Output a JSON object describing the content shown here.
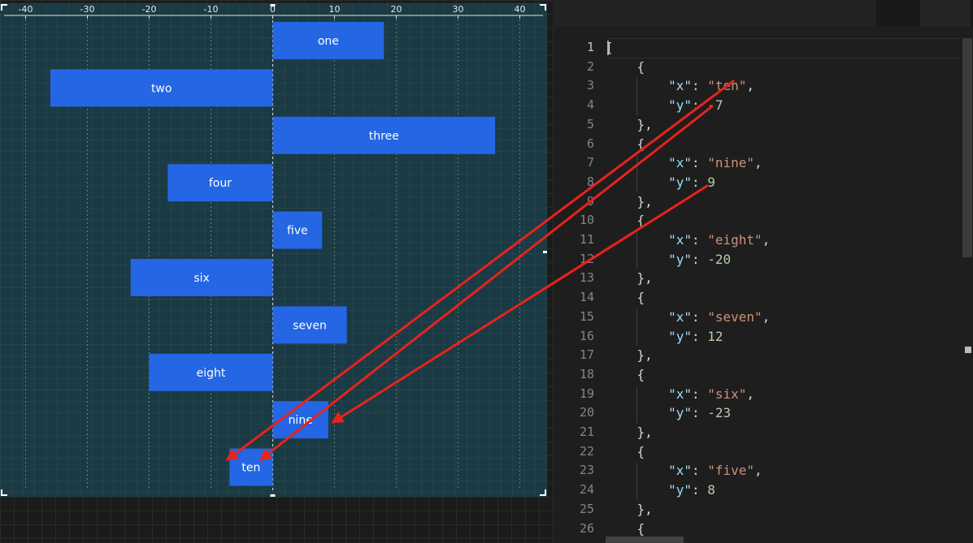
{
  "chart_data": {
    "type": "bar",
    "orientation": "horizontal",
    "categories": [
      "one",
      "two",
      "three",
      "four",
      "five",
      "six",
      "seven",
      "eight",
      "nine",
      "ten"
    ],
    "values": [
      18,
      -36,
      36,
      -17,
      8,
      -23,
      12,
      -20,
      9,
      -7
    ],
    "xlim": [
      -42,
      44
    ],
    "ticks": [
      -40,
      -30,
      -20,
      -10,
      0,
      10,
      20,
      30,
      40
    ],
    "tick_labels": [
      "-40",
      "-30",
      "-20",
      "-10",
      "0",
      "10",
      "20",
      "30",
      "40"
    ],
    "grid": true,
    "bar_color": "#2466e3"
  },
  "editor": {
    "line_numbers": [
      "1",
      "2",
      "3",
      "4",
      "5",
      "6",
      "7",
      "8",
      "9",
      "10",
      "11",
      "12",
      "13",
      "14",
      "15",
      "16",
      "17",
      "18",
      "19",
      "20",
      "21",
      "22",
      "23",
      "24",
      "25",
      "26"
    ],
    "active_line": 1,
    "lines": [
      [
        {
          "t": "p",
          "v": "["
        }
      ],
      [
        {
          "t": "p",
          "v": "    {"
        }
      ],
      [
        {
          "t": "p",
          "v": "        "
        },
        {
          "t": "k",
          "v": "\"x\""
        },
        {
          "t": "p",
          "v": ": "
        },
        {
          "t": "s",
          "v": "\"ten\""
        },
        {
          "t": "p",
          "v": ","
        }
      ],
      [
        {
          "t": "p",
          "v": "        "
        },
        {
          "t": "k",
          "v": "\"y\""
        },
        {
          "t": "p",
          "v": ": "
        },
        {
          "t": "n",
          "v": "-7"
        }
      ],
      [
        {
          "t": "p",
          "v": "    },"
        }
      ],
      [
        {
          "t": "p",
          "v": "    {"
        }
      ],
      [
        {
          "t": "p",
          "v": "        "
        },
        {
          "t": "k",
          "v": "\"x\""
        },
        {
          "t": "p",
          "v": ": "
        },
        {
          "t": "s",
          "v": "\"nine\""
        },
        {
          "t": "p",
          "v": ","
        }
      ],
      [
        {
          "t": "p",
          "v": "        "
        },
        {
          "t": "k",
          "v": "\"y\""
        },
        {
          "t": "p",
          "v": ": "
        },
        {
          "t": "n",
          "v": "9"
        }
      ],
      [
        {
          "t": "p",
          "v": "    },"
        }
      ],
      [
        {
          "t": "p",
          "v": "    {"
        }
      ],
      [
        {
          "t": "p",
          "v": "        "
        },
        {
          "t": "k",
          "v": "\"x\""
        },
        {
          "t": "p",
          "v": ": "
        },
        {
          "t": "s",
          "v": "\"eight\""
        },
        {
          "t": "p",
          "v": ","
        }
      ],
      [
        {
          "t": "p",
          "v": "        "
        },
        {
          "t": "k",
          "v": "\"y\""
        },
        {
          "t": "p",
          "v": ": "
        },
        {
          "t": "n",
          "v": "-20"
        }
      ],
      [
        {
          "t": "p",
          "v": "    },"
        }
      ],
      [
        {
          "t": "p",
          "v": "    {"
        }
      ],
      [
        {
          "t": "p",
          "v": "        "
        },
        {
          "t": "k",
          "v": "\"x\""
        },
        {
          "t": "p",
          "v": ": "
        },
        {
          "t": "s",
          "v": "\"seven\""
        },
        {
          "t": "p",
          "v": ","
        }
      ],
      [
        {
          "t": "p",
          "v": "        "
        },
        {
          "t": "k",
          "v": "\"y\""
        },
        {
          "t": "p",
          "v": ": "
        },
        {
          "t": "n",
          "v": "12"
        }
      ],
      [
        {
          "t": "p",
          "v": "    },"
        }
      ],
      [
        {
          "t": "p",
          "v": "    {"
        }
      ],
      [
        {
          "t": "p",
          "v": "        "
        },
        {
          "t": "k",
          "v": "\"x\""
        },
        {
          "t": "p",
          "v": ": "
        },
        {
          "t": "s",
          "v": "\"six\""
        },
        {
          "t": "p",
          "v": ","
        }
      ],
      [
        {
          "t": "p",
          "v": "        "
        },
        {
          "t": "k",
          "v": "\"y\""
        },
        {
          "t": "p",
          "v": ": "
        },
        {
          "t": "n",
          "v": "-23"
        }
      ],
      [
        {
          "t": "p",
          "v": "    },"
        }
      ],
      [
        {
          "t": "p",
          "v": "    {"
        }
      ],
      [
        {
          "t": "p",
          "v": "        "
        },
        {
          "t": "k",
          "v": "\"x\""
        },
        {
          "t": "p",
          "v": ": "
        },
        {
          "t": "s",
          "v": "\"five\""
        },
        {
          "t": "p",
          "v": ","
        }
      ],
      [
        {
          "t": "p",
          "v": "        "
        },
        {
          "t": "k",
          "v": "\"y\""
        },
        {
          "t": "p",
          "v": ": "
        },
        {
          "t": "n",
          "v": "8"
        }
      ],
      [
        {
          "t": "p",
          "v": "    },"
        }
      ],
      [
        {
          "t": "p",
          "v": "    {"
        }
      ]
    ]
  },
  "annotation": {
    "arrow_color": "#e8231c",
    "arrows": [
      {
        "name": "arrow-ten-label-to-ten-bar",
        "from": "editor-line-3",
        "to": "bar-ten"
      },
      {
        "name": "arrow-ten-value-to-ten-bar",
        "from": "editor-line-4",
        "to": "bar-ten"
      },
      {
        "name": "arrow-nine-value-to-nine-bar",
        "from": "editor-line-8",
        "to": "bar-nine"
      }
    ]
  },
  "colors": {
    "chart_bg": "#1a3a44",
    "editor_bg": "#1e1e1e",
    "json_key": "#9cdcfe",
    "json_string": "#ce9178",
    "json_number": "#b5cea8"
  }
}
